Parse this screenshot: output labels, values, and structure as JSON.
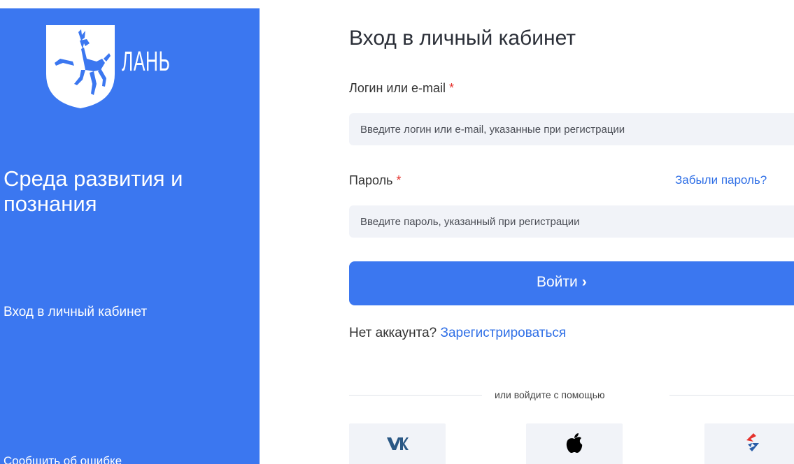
{
  "sidebar": {
    "logo_wordmark": "ЛАНЬ",
    "tagline": "Среда развития и познания",
    "subtitle": "Вход в личный кабинет",
    "report_link": "Сообщить об ошибке"
  },
  "form": {
    "title": "Вход в личный кабинет",
    "login_label": "Логин или e-mail",
    "login_placeholder": "Введите логин или e-mail, указанные при регистрации",
    "password_label": "Пароль",
    "required_mark": "*",
    "forgot_password": "Забыли пароль?",
    "password_placeholder": "Введите пароль, указанный при регистрации",
    "submit_label": "Войти",
    "submit_chevron": "›",
    "no_account_text": "Нет аккаунта?",
    "register_link": "Зарегистрироваться",
    "divider_text": "или войдите с помощью"
  },
  "social": [
    {
      "name": "vk-icon"
    },
    {
      "name": "apple-icon"
    },
    {
      "name": "esia-icon"
    }
  ],
  "colors": {
    "primary": "#3b77f0",
    "link": "#2f6fe6",
    "required": "#e5322d",
    "input_bg": "#f1f3f8",
    "vk": "#2a5885"
  }
}
